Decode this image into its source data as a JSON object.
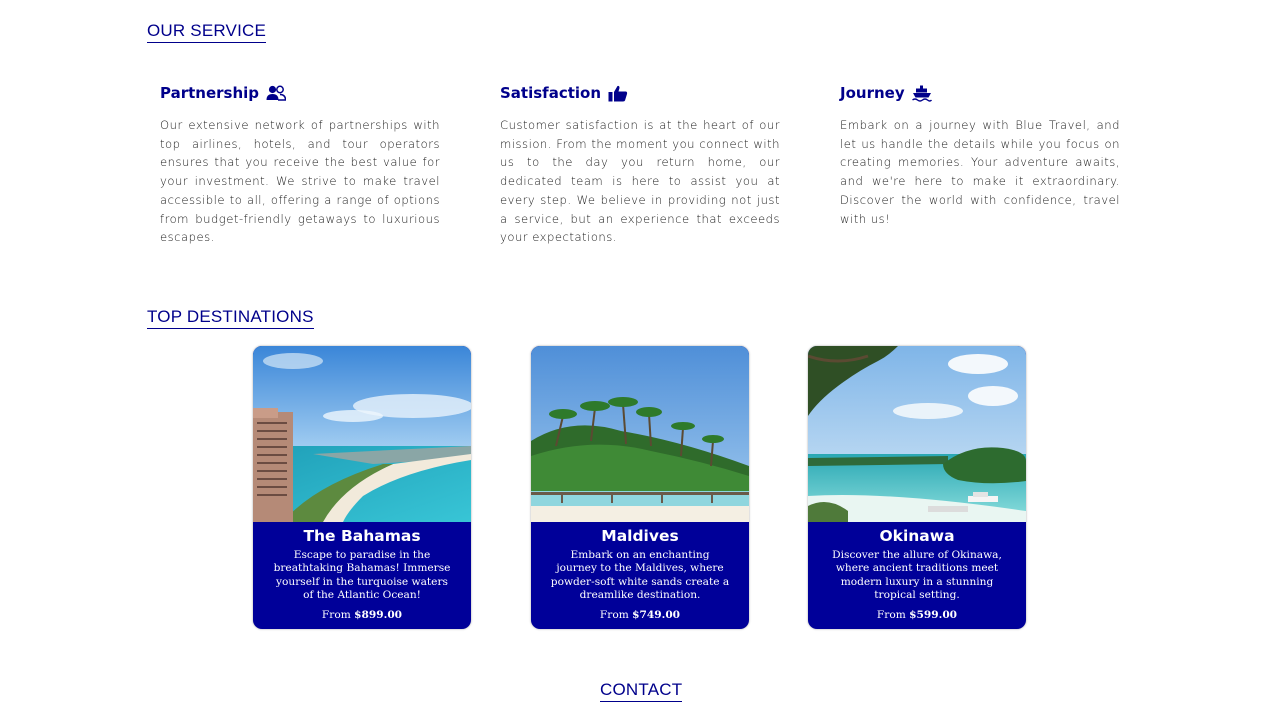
{
  "sections": {
    "service_title": "OUR SERVICE",
    "destinations_title": "TOP DESTINATIONS",
    "contact_title": "CONTACT"
  },
  "services": [
    {
      "title": "Partnership",
      "icon": "handshake-person-icon",
      "text": " Our extensive network of partnerships with top airlines, hotels, and tour operators ensures that you receive the best value for your investment. We strive to make travel accessible to all, offering a range of options from budget-friendly getaways to luxurious escapes."
    },
    {
      "title": "Satisfaction",
      "icon": "thumbs-up-icon",
      "text": " Customer satisfaction is at the heart of our mission. From the moment you connect with us to the day you return home, our dedicated team is here to assist you at every step. We believe in providing not just a service, but an experience that exceeds your expectations."
    },
    {
      "title": "Journey",
      "icon": "ship-icon",
      "text": " Embark on a journey with Blue Travel, and let us handle the details while you focus on creating memories. Your adventure awaits, and we're here to make it extraordinary. Discover the world with confidence, travel with us!"
    }
  ],
  "destinations": [
    {
      "name": "The Bahamas",
      "description": "Escape to paradise in the breathtaking Bahamas! Immerse yourself in the turquoise waters of the Atlantic Ocean!",
      "price_prefix": "From",
      "price": "$899.00"
    },
    {
      "name": "Maldives",
      "description": "Embark on an enchanting journey to the Maldives, where powder-soft white sands create a dreamlike destination.",
      "price_prefix": "From",
      "price": "$749.00"
    },
    {
      "name": "Okinawa",
      "description": "Discover the allure of Okinawa, where ancient traditions meet modern luxury in a stunning tropical setting.",
      "price_prefix": "From",
      "price": "$599.00"
    }
  ],
  "colors": {
    "accent": "#00008b",
    "card_bg": "#000099"
  }
}
